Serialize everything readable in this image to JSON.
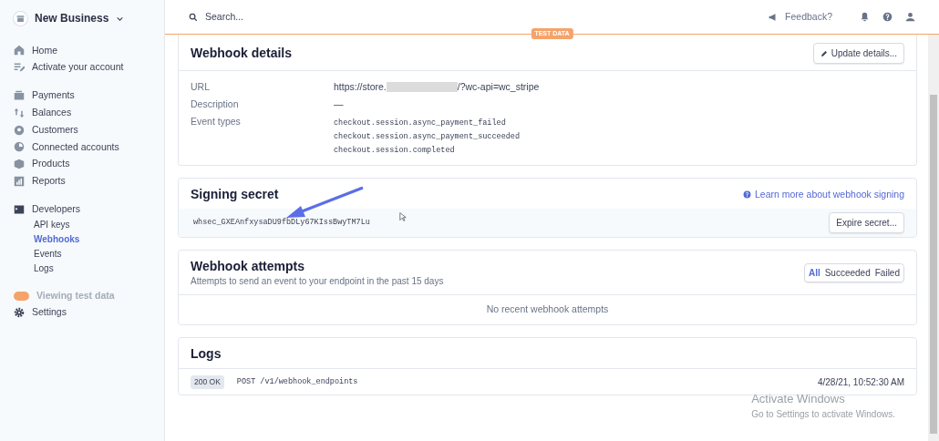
{
  "business": {
    "name": "New Business"
  },
  "sidebar": {
    "groups": [
      [
        {
          "label": "Home",
          "selected": false
        },
        {
          "label": "Activate your account",
          "selected": false
        }
      ],
      [
        {
          "label": "Payments",
          "selected": false
        },
        {
          "label": "Balances",
          "selected": false
        },
        {
          "label": "Customers",
          "selected": false
        },
        {
          "label": "Connected accounts",
          "selected": false
        },
        {
          "label": "Products",
          "selected": false
        },
        {
          "label": "Reports",
          "selected": false
        }
      ],
      [
        {
          "label": "Developers",
          "selected": false,
          "children": [
            {
              "label": "API keys",
              "selected": false
            },
            {
              "label": "Webhooks",
              "selected": true
            },
            {
              "label": "Events",
              "selected": false
            },
            {
              "label": "Logs",
              "selected": false
            }
          ]
        }
      ]
    ],
    "test_toggle": {
      "label": "Viewing test data",
      "on": true
    },
    "settings": {
      "label": "Settings",
      "selected": false
    }
  },
  "topbar": {
    "search": {
      "placeholder": "Search..."
    },
    "feedback": "Feedback?"
  },
  "test_badge": "TEST DATA",
  "webhook_details": {
    "title": "Webhook details",
    "button": "Update details...",
    "fields": [
      {
        "kind": "url",
        "label": "URL",
        "value_start": "https://store.",
        "value_end": "/?wc-api=wc_stripe"
      },
      {
        "kind": "text",
        "label": "Description",
        "value": "—"
      },
      {
        "kind": "list",
        "label": "Event types",
        "values": [
          "checkout.session.async_payment_failed",
          "checkout.session.async_payment_succeeded",
          "checkout.session.completed"
        ]
      }
    ]
  },
  "signing_secret": {
    "title": "Signing secret",
    "link": "Learn more about webhook signing",
    "secret": "whsec_GXEAnfxysaDU9fbDLy67KIssBwyTM7Lu",
    "button": "Expire secret..."
  },
  "webhook_attempts": {
    "title": "Webhook attempts",
    "subtitle": "Attempts to send an event to your endpoint in the past 15 days",
    "filters": [
      {
        "label": "All",
        "selected": true
      },
      {
        "label": "Succeeded",
        "selected": false
      },
      {
        "label": "Failed",
        "selected": false
      }
    ],
    "empty": "No recent webhook attempts"
  },
  "logs": {
    "title": "Logs",
    "entries": [
      {
        "status": "200 OK",
        "request": "POST /v1/webhook_endpoints",
        "time": "4/28/21, 10:52:30 AM"
      }
    ]
  },
  "os_overlay": {
    "title": "Activate Windows",
    "subtitle": "Go to Settings to activate Windows."
  }
}
